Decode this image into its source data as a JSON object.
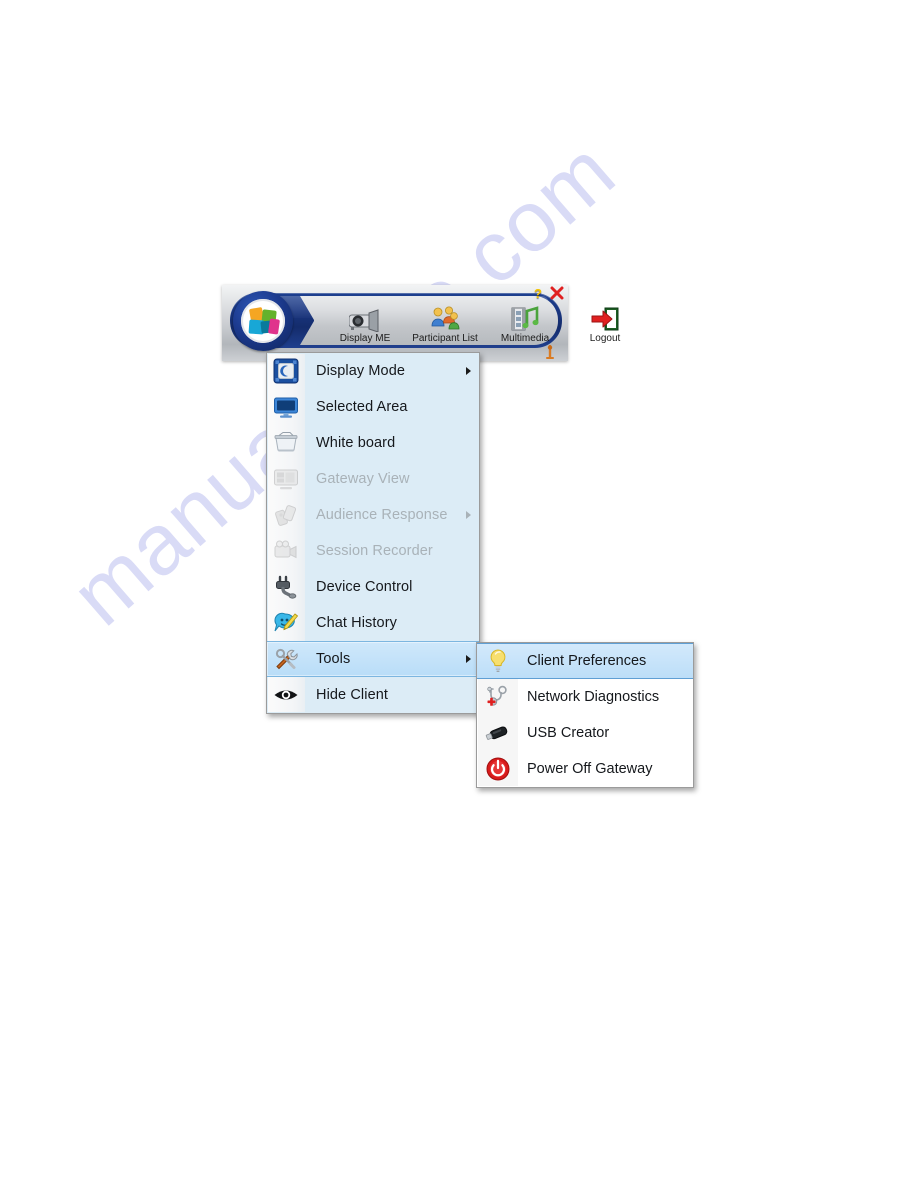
{
  "page": {
    "background_color": "#ffffff",
    "watermark_text": "manualshive.com",
    "watermark_color": "#d9dbf6"
  },
  "toolbar": {
    "name": "client-toolbar",
    "logo_icon": "colored-squares-logo-icon",
    "help_label": "?",
    "close_label": "×",
    "accent_navy": "#1a3782",
    "buttons": [
      {
        "label": "Display ME",
        "icon": "projector-icon"
      },
      {
        "label": "Participant List",
        "icon": "people-group-icon"
      },
      {
        "label": "Multimedia",
        "icon": "film-music-icon"
      },
      {
        "label": "Logout",
        "icon": "exit-door-arrow-icon"
      }
    ]
  },
  "main_menu": {
    "items": [
      {
        "label": "Display Mode",
        "icon": "display-mode-icon",
        "disabled": false,
        "has_submenu": true,
        "selected": false
      },
      {
        "label": "Selected Area",
        "icon": "monitor-icon",
        "disabled": false,
        "has_submenu": false,
        "selected": false
      },
      {
        "label": "White board",
        "icon": "whiteboard-icon",
        "disabled": false,
        "has_submenu": false,
        "selected": false
      },
      {
        "label": "Gateway View",
        "icon": "gateway-view-icon",
        "disabled": true,
        "has_submenu": false,
        "selected": false
      },
      {
        "label": "Audience Response",
        "icon": "audience-response-icon",
        "disabled": true,
        "has_submenu": true,
        "selected": false
      },
      {
        "label": "Session Recorder",
        "icon": "video-camera-icon",
        "disabled": true,
        "has_submenu": false,
        "selected": false
      },
      {
        "label": "Device Control",
        "icon": "power-plug-icon",
        "disabled": false,
        "has_submenu": false,
        "selected": false
      },
      {
        "label": "Chat History",
        "icon": "chat-bubble-pen-icon",
        "disabled": false,
        "has_submenu": false,
        "selected": false
      },
      {
        "label": "Tools",
        "icon": "tools-wrench-icon",
        "disabled": false,
        "has_submenu": true,
        "selected": true
      },
      {
        "label": "Hide Client",
        "icon": "eye-icon",
        "disabled": false,
        "has_submenu": false,
        "selected": false
      }
    ]
  },
  "sub_menu": {
    "parent": "Tools",
    "items": [
      {
        "label": "Client Preferences",
        "icon": "lightbulb-icon",
        "selected": true
      },
      {
        "label": "Network Diagnostics",
        "icon": "stethoscope-icon",
        "selected": false
      },
      {
        "label": "USB Creator",
        "icon": "usb-drive-icon",
        "selected": false
      },
      {
        "label": "Power Off Gateway",
        "icon": "power-button-icon",
        "selected": false
      }
    ]
  }
}
